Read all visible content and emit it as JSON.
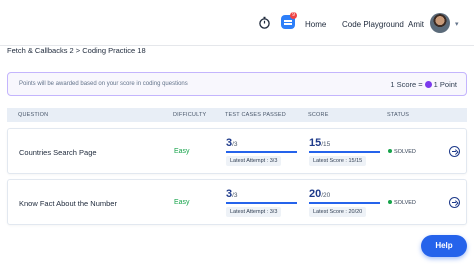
{
  "header": {
    "nav": [
      "Home",
      "Code Playground"
    ],
    "user_name": "Amit",
    "notification_count": "9"
  },
  "breadcrumb": "Fetch & Callbacks 2 > Coding Practice 18",
  "banner": {
    "message": "Points will be awarded based on your score in coding questions",
    "score_label": "1 Score =",
    "point_label": "1 Point"
  },
  "table": {
    "columns": [
      "QUESTION",
      "DIFFICULTY",
      "TEST CASES PASSED",
      "SCORE",
      "STATUS"
    ],
    "rows": [
      {
        "question": "Countries Search Page",
        "difficulty": "Easy",
        "tests_passed": "3",
        "tests_total": "/3",
        "tests_progress": 1.0,
        "latest_attempt": "Latest Attempt : 3/3",
        "score": "15",
        "score_total": "/15",
        "score_progress": 1.0,
        "latest_score": "Latest Score : 15/15",
        "status": "SOLVED"
      },
      {
        "question": "Know Fact About the Number",
        "difficulty": "Easy",
        "tests_passed": "3",
        "tests_total": "/3",
        "tests_progress": 1.0,
        "latest_attempt": "Latest Attempt : 3/3",
        "score": "20",
        "score_total": "/20",
        "score_progress": 1.0,
        "latest_score": "Latest Score : 20/20",
        "status": "SOLVED"
      }
    ]
  },
  "help_label": "Help",
  "colors": {
    "accent": "#2563eb",
    "success": "#16a34a",
    "banner_border": "#c4b5fd"
  }
}
